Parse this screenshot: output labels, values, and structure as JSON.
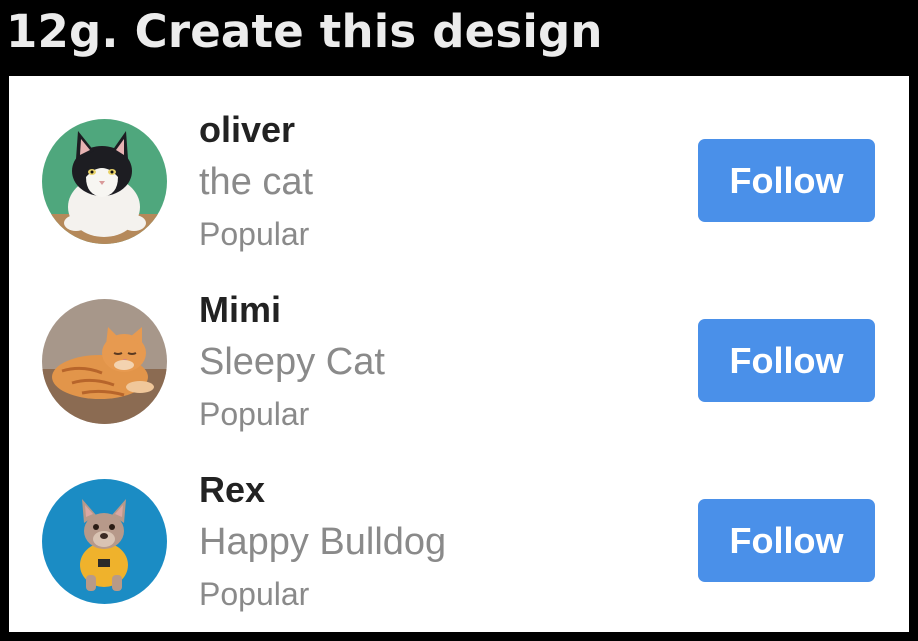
{
  "heading": "12g. Create this design",
  "colors": {
    "background": "#000000",
    "panel": "#ffffff",
    "button": "#4a90e9",
    "name_text": "#222222",
    "muted_text": "#8a8a8a"
  },
  "users": [
    {
      "name": "oliver",
      "subtitle": "the cat",
      "tag": "Popular",
      "follow_label": "Follow",
      "avatar": "cat-photo"
    },
    {
      "name": "Mimi",
      "subtitle": "Sleepy Cat",
      "tag": "Popular",
      "follow_label": "Follow",
      "avatar": "sleeping-cat-photo"
    },
    {
      "name": "Rex",
      "subtitle": "Happy Bulldog",
      "tag": "Popular",
      "follow_label": "Follow",
      "avatar": "bulldog-photo"
    }
  ]
}
